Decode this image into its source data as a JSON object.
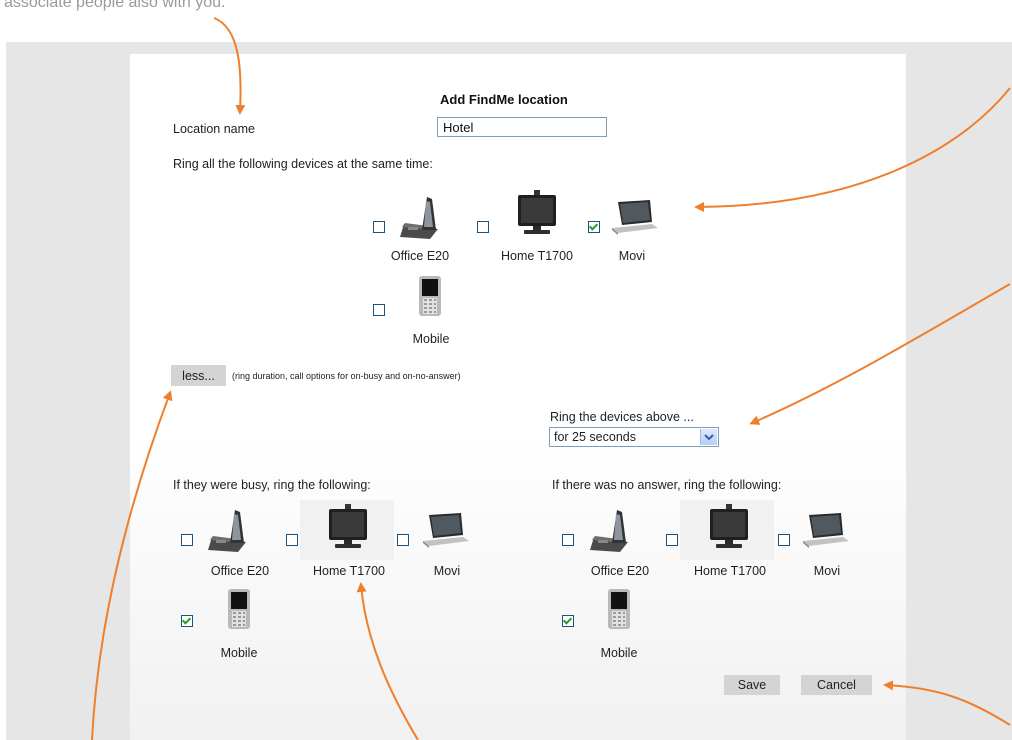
{
  "caption_text": "associate people also with you.",
  "dialog": {
    "title": "Add FindMe location",
    "location_label": "Location name",
    "location_value": "Hotel",
    "ring_all_label": "Ring all the following devices at the same time:",
    "devices_main": [
      {
        "name": "Office E20",
        "checked": false,
        "icon": "desk-phone-icon"
      },
      {
        "name": "Home T1700",
        "checked": false,
        "icon": "video-monitor-icon"
      },
      {
        "name": "Movi",
        "checked": true,
        "icon": "laptop-icon"
      },
      {
        "name": "Mobile",
        "checked": false,
        "icon": "mobile-phone-icon"
      }
    ],
    "less_button": "less...",
    "less_note": "(ring duration, call options for on-busy and on-no-answer)",
    "ring_duration_label": "Ring the devices above ...",
    "ring_duration_value": "for 25 seconds",
    "busy_label": "If they were busy, ring the following:",
    "busy_devices": [
      {
        "name": "Office E20",
        "checked": false
      },
      {
        "name": "Home T1700",
        "checked": false
      },
      {
        "name": "Movi",
        "checked": false
      },
      {
        "name": "Mobile",
        "checked": true
      }
    ],
    "noanswer_label": "If there was no answer, ring the following:",
    "noanswer_devices": [
      {
        "name": "Office E20",
        "checked": false
      },
      {
        "name": "Home T1700",
        "checked": false
      },
      {
        "name": "Movi",
        "checked": false
      },
      {
        "name": "Mobile",
        "checked": true
      }
    ],
    "save_button": "Save",
    "cancel_button": "Cancel"
  },
  "colors": {
    "annotation_arrow": "#ee7f2d",
    "panel_bg": "#e6e6e6",
    "button_bg": "#d4d4d4",
    "checkbox_border": "#1c5180",
    "checkmark": "#21a121"
  }
}
